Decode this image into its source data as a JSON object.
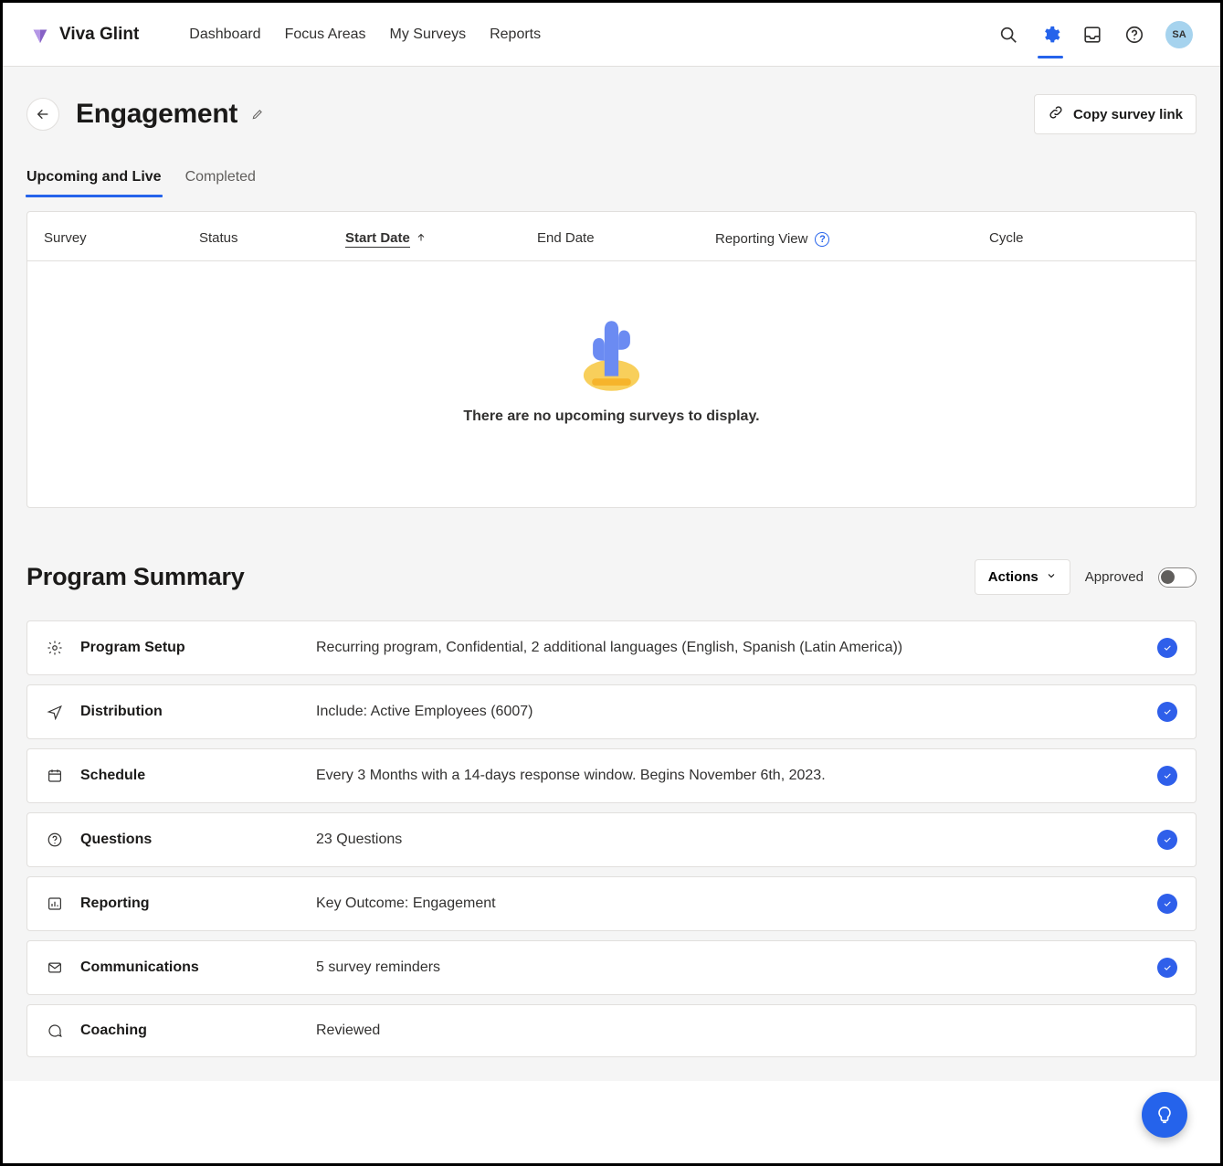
{
  "header": {
    "brand": "Viva Glint",
    "nav": {
      "dashboard": "Dashboard",
      "focus_areas": "Focus Areas",
      "my_surveys": "My Surveys",
      "reports": "Reports"
    },
    "avatar": "SA"
  },
  "page": {
    "title": "Engagement",
    "copy_link": "Copy survey link"
  },
  "tabs": {
    "upcoming": "Upcoming and Live",
    "completed": "Completed"
  },
  "columns": {
    "survey": "Survey",
    "status": "Status",
    "start": "Start Date",
    "end": "End Date",
    "report": "Reporting View",
    "cycle": "Cycle"
  },
  "empty_text": "There are no upcoming surveys to display.",
  "summary": {
    "title": "Program Summary",
    "actions": "Actions",
    "approved": "Approved",
    "rows": {
      "setup": {
        "title": "Program Setup",
        "desc": "Recurring program, Confidential, 2 additional languages (English, Spanish (Latin America))"
      },
      "dist": {
        "title": "Distribution",
        "desc": "Include: Active Employees (6007)"
      },
      "schedule": {
        "title": "Schedule",
        "desc": "Every 3 Months with a 14-days response window. Begins November 6th, 2023."
      },
      "questions": {
        "title": "Questions",
        "desc": "23 Questions"
      },
      "reporting": {
        "title": "Reporting",
        "desc": "Key Outcome: Engagement"
      },
      "comms": {
        "title": "Communications",
        "desc": "5 survey reminders"
      },
      "coaching": {
        "title": "Coaching",
        "desc": "Reviewed"
      }
    }
  }
}
